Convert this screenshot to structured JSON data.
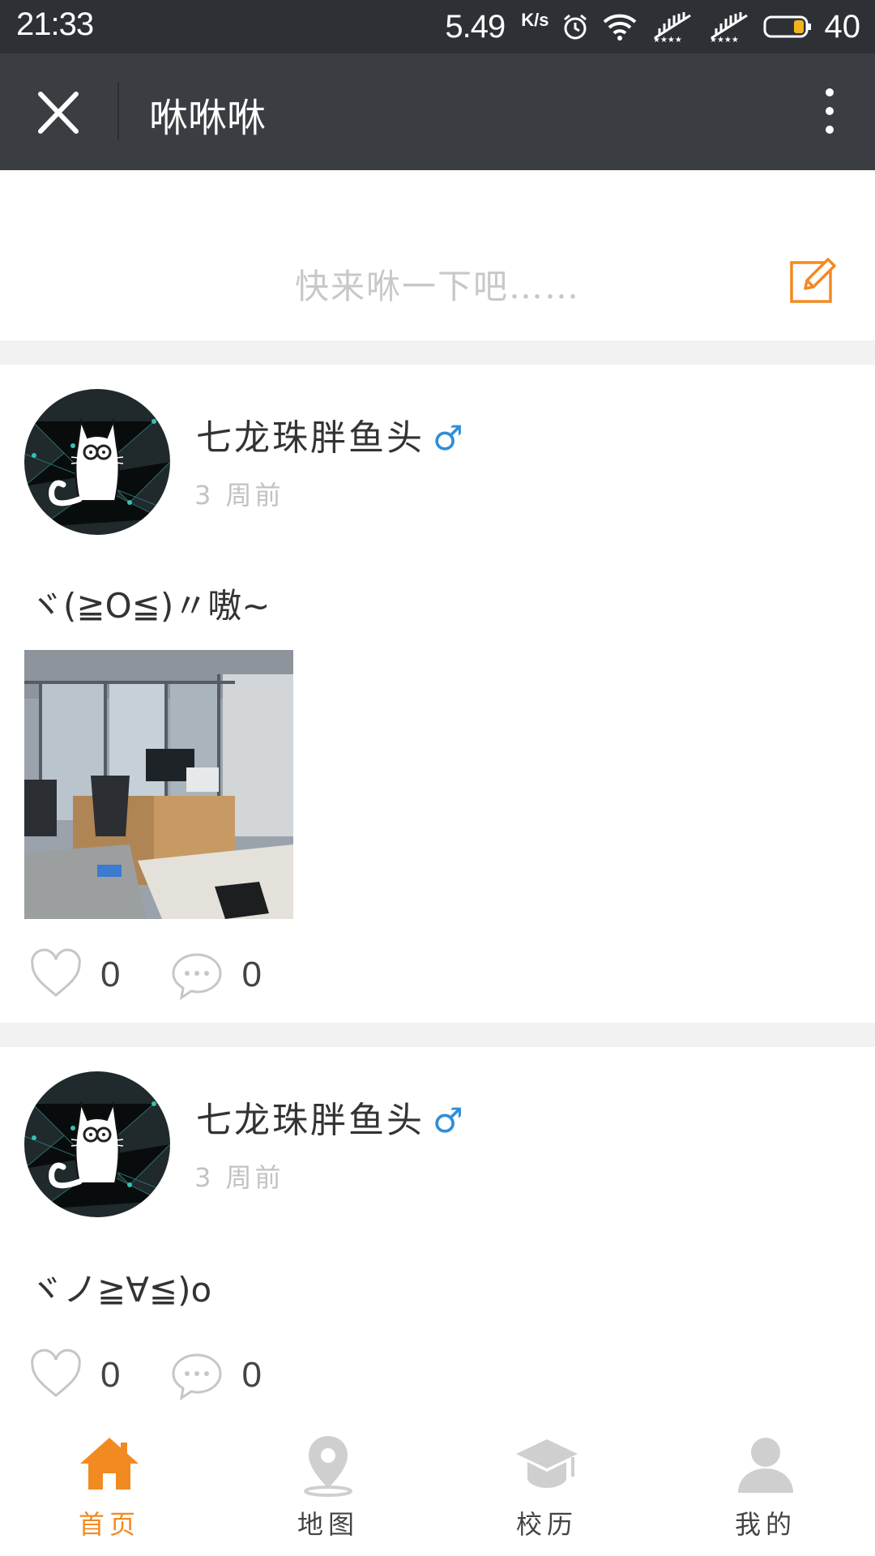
{
  "status_bar": {
    "time": "21:33",
    "speed": "5.49",
    "speed_unit": "K/s",
    "battery": "40"
  },
  "header": {
    "title": "咻咻咻",
    "close_icon": "close-icon",
    "more_icon": "more-vertical-icon"
  },
  "compose": {
    "placeholder": "快来咻一下吧……",
    "icon": "edit-icon",
    "accent": "#f28a22"
  },
  "posts": [
    {
      "author": "七龙珠胖鱼头",
      "gender": "♂",
      "time": "3 周前",
      "content": "ヾ(≧O≦)〃嗷~",
      "likes": "0",
      "comments": "0"
    },
    {
      "author": "七龙珠胖鱼头",
      "gender": "♂",
      "time": "3 周前",
      "content": "ヾノ≧∀≦)o",
      "likes": "0",
      "comments": "0"
    }
  ],
  "tabbar": {
    "items": [
      {
        "label": "首页",
        "icon": "home-icon",
        "active": true
      },
      {
        "label": "地图",
        "icon": "map-pin-icon",
        "active": false
      },
      {
        "label": "校历",
        "icon": "graduation-cap-icon",
        "active": false
      },
      {
        "label": "我的",
        "icon": "user-icon",
        "active": false
      }
    ]
  },
  "colors": {
    "accent": "#f28a22",
    "gender": "#2f8ed8",
    "title_bar": "#3a3e43",
    "status_bar": "#2d3136"
  }
}
